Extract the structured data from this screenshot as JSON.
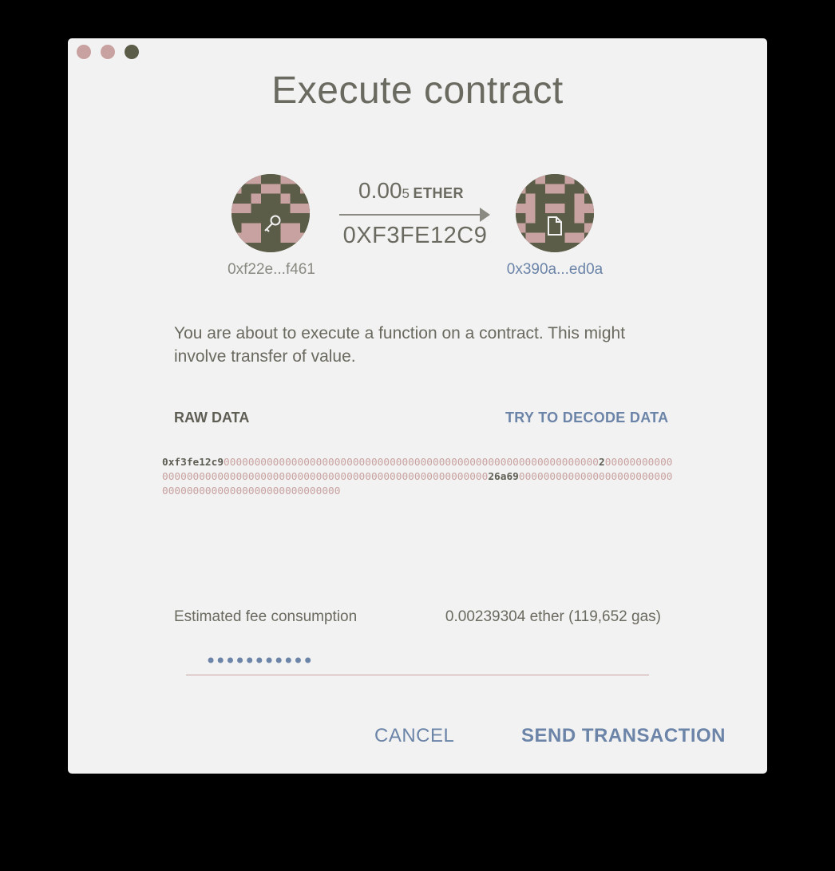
{
  "window": {
    "title": "Execute contract"
  },
  "from": {
    "address": "0xf22e...f461",
    "icon": "key-icon"
  },
  "to": {
    "address": "0x390a...ed0a",
    "icon": "document-icon"
  },
  "transfer": {
    "amount_main": "0.00",
    "amount_sub": "5",
    "unit": "ETHER",
    "function_name": "0XF3FE12C9"
  },
  "description": "You are about to execute a function on a contract. This might involve transfer of value.",
  "raw_data": {
    "label": "RAW DATA",
    "decode_link": "TRY TO DECODE DATA",
    "selector": "0xf3fe12c9",
    "seg1": "0000000000000000000000000000000000000000000000000000000000000",
    "highlight1": "2",
    "seg2": "0000000000000000000000000000000000000000000000000000000000000000",
    "highlight2": "26a69",
    "seg3": "000000000000000000000000000000000000000000000000000000"
  },
  "fee": {
    "label": "Estimated fee consumption",
    "value": "0.00239304 ether (119,652 gas)"
  },
  "password": {
    "value": "•••••••••••"
  },
  "buttons": {
    "cancel": "CANCEL",
    "send": "SEND TRANSACTION"
  },
  "colors": {
    "accent": "#6b84a8",
    "identicon_dark": "#5c5d48",
    "identicon_light": "#c8a2a0",
    "text": "#6a6a60"
  }
}
